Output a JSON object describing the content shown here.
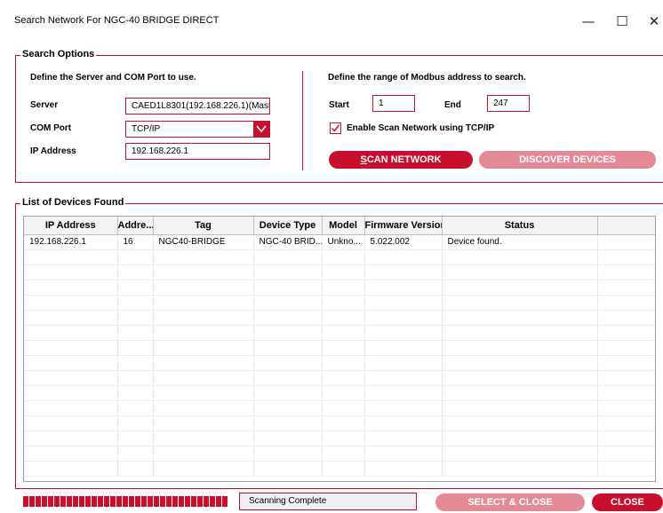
{
  "window": {
    "title": "Search Network For NGC-40 BRIDGE DIRECT",
    "minimize": "—",
    "maximize": "☐",
    "close": "✕"
  },
  "search_options": {
    "group_label": "Search Options",
    "server_heading": "Define the Server and COM Port to use.",
    "server_label": "Server",
    "server_value": "CAED1L8301(192.168.226.1)(Mast",
    "com_port_label": "COM Port",
    "com_port_value": "TCP/IP",
    "ip_label": "IP Address",
    "ip_value": "192.168.226.1",
    "range_heading": "Define the range of Modbus address to search.",
    "start_label": "Start",
    "start_value": "1",
    "end_label": "End",
    "end_value": "247",
    "scan_tcp_label": "Enable Scan Network using TCP/IP",
    "scan_tcp_checked": true,
    "scan_button_first": "S",
    "scan_button_rest": "CAN NETWORK",
    "discover_button": "DISCOVER DEVICES"
  },
  "devices": {
    "group_label": "List of Devices Found",
    "columns": [
      "IP Address",
      "Addre...",
      "Tag",
      "Device Type",
      "Model",
      "Firmware Version",
      "Status",
      ""
    ],
    "rows": [
      [
        "192.168.226.1",
        "16",
        "NGC40-BRIDGE",
        "NGC-40 BRID...",
        "Unkno...",
        "5.022.002",
        "Device found.",
        ""
      ]
    ],
    "empty_rows": 15
  },
  "footer": {
    "progress": 1.0,
    "status_text": "Scanning Complete",
    "select_close": "SELECT & CLOSE",
    "close": "CLOSE"
  },
  "colors": {
    "accent": "#c8102e",
    "accent_disabled": "#e48a97"
  }
}
